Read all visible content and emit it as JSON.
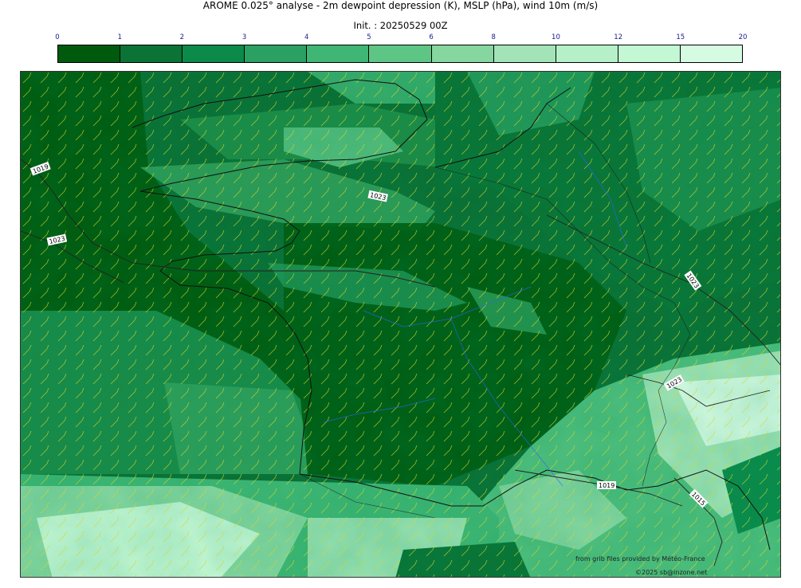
{
  "header": {
    "title": "AROME 0.025° analyse - 2m dewpoint depression (K), MSLP (hPa), wind 10m (m/s)",
    "init": "Init. : 20250529 00Z"
  },
  "colorbar": {
    "ticks": [
      "0",
      "1",
      "2",
      "3",
      "4",
      "5",
      "6",
      "8",
      "10",
      "12",
      "15",
      "20"
    ],
    "colors": [
      "#005a0e",
      "#0a7335",
      "#0b8a4a",
      "#2aa062",
      "#3fb674",
      "#5ec685",
      "#86d6a0",
      "#a2e4b7",
      "#b5f0c8",
      "#c4f7d4",
      "#d6fbe3"
    ]
  },
  "map": {
    "isobars": [
      {
        "label": "1019"
      },
      {
        "label": "1023"
      },
      {
        "label": "1023"
      },
      {
        "label": "1023"
      },
      {
        "label": "1023"
      },
      {
        "label": "1019"
      },
      {
        "label": "1015"
      }
    ]
  },
  "credits": {
    "source": "from grib files provided by Météo-France",
    "copyright": "©2025 sb@inzone.net"
  }
}
